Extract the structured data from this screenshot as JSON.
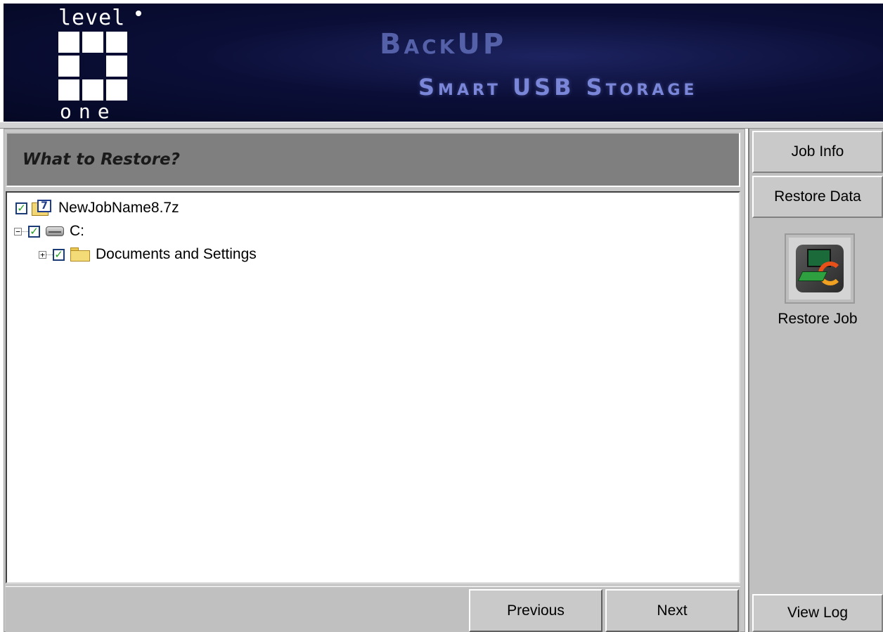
{
  "header": {
    "logo_top_text": "level",
    "logo_bottom_text": "one",
    "product_title": "BackUP",
    "product_subtitle": "Smart USB Storage"
  },
  "restore": {
    "section_title": "What to Restore?",
    "tree": [
      {
        "label": "NewJobName8.7z",
        "checked": true,
        "icon": "archive-7z-icon",
        "expander": null
      },
      {
        "label": "C:",
        "checked": true,
        "icon": "drive-icon",
        "expander": "−"
      },
      {
        "label": "Documents and Settings",
        "checked": true,
        "icon": "folder-icon",
        "expander": "+"
      }
    ]
  },
  "nav": {
    "previous_label": "Previous",
    "next_label": "Next"
  },
  "sidebar": {
    "job_info_label": "Job Info",
    "restore_data_label": "Restore Data",
    "restore_job_label": "Restore Job",
    "view_log_label": "View Log"
  },
  "colors": {
    "header_bg": "#0b0f38",
    "title_color": "#5460a8",
    "panel_bg": "#c0c0c0",
    "section_bar": "#7f7f7f",
    "check_color": "#21a121"
  }
}
